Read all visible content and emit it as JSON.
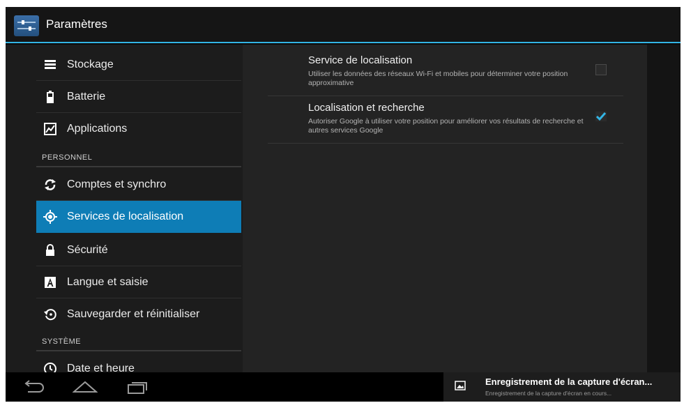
{
  "app": {
    "title": "Paramètres",
    "icon": "settings-sliders-icon"
  },
  "sidebar": {
    "items_top": [
      {
        "label": "Stockage",
        "icon": "storage-icon"
      },
      {
        "label": "Batterie",
        "icon": "battery-icon"
      },
      {
        "label": "Applications",
        "icon": "applications-icon"
      }
    ],
    "section_personnel": "PERSONNEL",
    "items_personnel": [
      {
        "label": "Comptes et synchro",
        "icon": "sync-icon"
      },
      {
        "label": "Services de localisation",
        "icon": "location-icon",
        "selected": true
      },
      {
        "label": "Sécurité",
        "icon": "lock-icon"
      },
      {
        "label": "Langue et saisie",
        "icon": "language-icon"
      },
      {
        "label": "Sauvegarder et réinitialiser",
        "icon": "backup-restore-icon"
      }
    ],
    "section_systeme": "SYSTÈME",
    "items_systeme": [
      {
        "label": "Date et heure",
        "icon": "clock-icon"
      }
    ]
  },
  "detail": {
    "prefs": [
      {
        "title": "Service de localisation",
        "summary": "Utiliser les données des réseaux Wi-Fi et mobiles pour déterminer votre position approximative",
        "checked": false
      },
      {
        "title": "Localisation et recherche",
        "summary": "Autoriser Google à utiliser votre position pour améliorer vos résultats de recherche et autres services Google",
        "checked": true
      }
    ]
  },
  "navbar": {
    "buttons": [
      "back-icon",
      "home-icon",
      "recent-apps-icon"
    ]
  },
  "notification": {
    "icon": "screenshot-image-icon",
    "title": "Enregistrement de la capture d'écran...",
    "text": "Enregistrement de la capture d'écran en cours..."
  },
  "colors": {
    "accent": "#33b5e5",
    "selected_bg": "#0e7db6",
    "checkmark": "#33b5e5"
  }
}
